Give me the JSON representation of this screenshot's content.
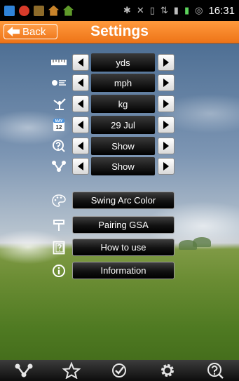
{
  "status_bar": {
    "time": "16:31"
  },
  "header": {
    "back_label": "Back",
    "title": "Settings"
  },
  "rows": [
    {
      "icon": "ruler-icon",
      "value": "yds"
    },
    {
      "icon": "speed-icon",
      "value": "mph"
    },
    {
      "icon": "golf-swing-icon",
      "value": "kg"
    },
    {
      "icon": "calendar-icon",
      "calendar_month": "MAY",
      "calendar_day": "12",
      "value": "29 Jul"
    },
    {
      "icon": "help-badge-icon",
      "value": "Show"
    },
    {
      "icon": "share-icon",
      "value": "Show"
    }
  ],
  "buttons": [
    {
      "icon": "palette-icon",
      "label": "Swing Arc Color"
    },
    {
      "icon": "plug-icon",
      "label": "Pairing GSA"
    },
    {
      "icon": "question-doc-icon",
      "label": "How to use"
    },
    {
      "icon": "info-icon",
      "label": "Information"
    }
  ],
  "bottom_bar": [
    "share-icon",
    "star-icon",
    "check-clock-icon",
    "gear-icon",
    "help-icon"
  ]
}
